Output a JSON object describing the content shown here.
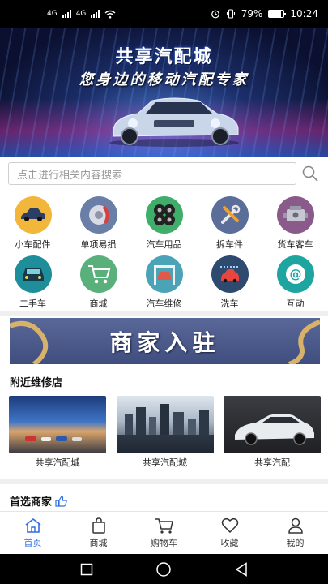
{
  "status_bar": {
    "network_1": "4G",
    "network_2": "4G",
    "battery_percent": "79%",
    "battery_level": 0.79,
    "time": "10:24",
    "icons": [
      "signal-icon",
      "wifi-icon",
      "alarm-icon",
      "vibrate-icon",
      "battery-icon"
    ]
  },
  "banner": {
    "title": "共享汽配城",
    "subtitle": "您身边的移动汽配专家"
  },
  "search": {
    "placeholder": "点击进行相关内容搜索"
  },
  "categories": [
    {
      "label": "小车配件",
      "icon": "car-icon",
      "color": "#f2b63a"
    },
    {
      "label": "单项易损",
      "icon": "brake-disc-icon",
      "color": "#6a7fa8"
    },
    {
      "label": "汽车用品",
      "icon": "tires-icon",
      "color": "#3fae6a"
    },
    {
      "label": "拆车件",
      "icon": "tools-icon",
      "color": "#5b6e9a"
    },
    {
      "label": "货车客车",
      "icon": "engine-icon",
      "color": "#8a5a8a"
    },
    {
      "label": "二手车",
      "icon": "used-car-icon",
      "color": "#1e8f9a"
    },
    {
      "label": "商城",
      "icon": "cart-icon",
      "color": "#5ab07a"
    },
    {
      "label": "汽车维修",
      "icon": "lift-icon",
      "color": "#4aa3b6"
    },
    {
      "label": "洗车",
      "icon": "car-wash-icon",
      "color": "#2e4a6e"
    },
    {
      "label": "互动",
      "icon": "at-icon",
      "color": "#1ea5a0"
    }
  ],
  "merchant_banner": {
    "text": "商家入驻"
  },
  "nearby": {
    "title": "附近维修店",
    "shops": [
      {
        "name": "共享汽配城"
      },
      {
        "name": "共享汽配城"
      },
      {
        "name": "共享汽配"
      }
    ]
  },
  "preferred": {
    "title": "首选商家"
  },
  "bottom_nav": [
    {
      "label": "首页",
      "icon": "home-icon",
      "active": true
    },
    {
      "label": "商城",
      "icon": "bag-icon",
      "active": false
    },
    {
      "label": "购物车",
      "icon": "cart-icon",
      "active": false
    },
    {
      "label": "收藏",
      "icon": "heart-icon",
      "active": false
    },
    {
      "label": "我的",
      "icon": "user-icon",
      "active": false
    }
  ],
  "colors": {
    "accent": "#2f6fe0"
  }
}
